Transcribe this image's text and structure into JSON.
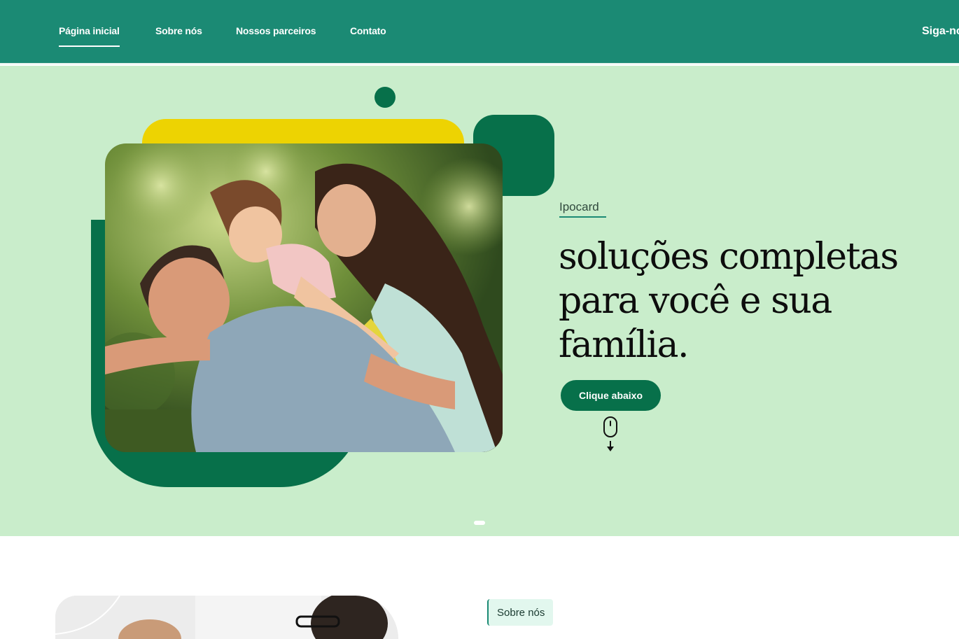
{
  "nav": {
    "items": [
      {
        "label": "Página inicial",
        "active": true
      },
      {
        "label": "Sobre nós",
        "active": false
      },
      {
        "label": "Nossos parceiros",
        "active": false
      },
      {
        "label": "Contato",
        "active": false
      }
    ],
    "follow_label": "Siga-no"
  },
  "hero": {
    "kicker": "Ipocard",
    "title": "soluções completas para você e sua família.",
    "button_label": "Clique abaixo",
    "scroll_icon": "mouse-scroll-icon",
    "slide_indicator": {
      "active": 1,
      "total": 1
    }
  },
  "about": {
    "tag": "Sobre nós"
  },
  "colors": {
    "nav_bg": "#1b8a74",
    "hero_bg": "#c9edcb",
    "accent_green": "#07704a",
    "accent_yellow": "#edd302"
  }
}
